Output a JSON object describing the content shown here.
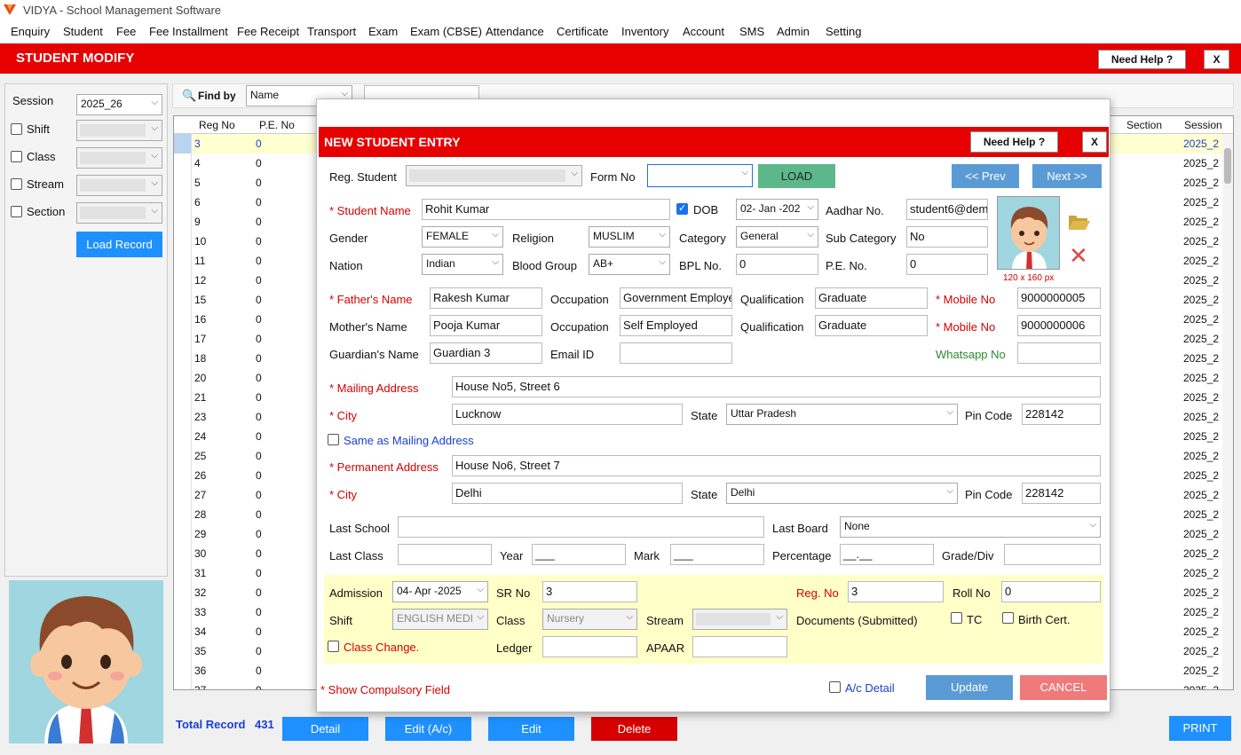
{
  "app": {
    "title": "VIDYA - School Management Software"
  },
  "menu": [
    "Enquiry",
    "Student",
    "Fee",
    "Fee Installment",
    "Fee Receipt",
    "Transport",
    "Exam",
    "Exam (CBSE)",
    "Attendance",
    "Certificate",
    "Inventory",
    "Account",
    "SMS",
    "Admin",
    "Setting"
  ],
  "page": {
    "title": "STUDENT MODIFY",
    "help": "Need Help ?",
    "close": "X"
  },
  "left": {
    "session_label": "Session",
    "session_value": "2025_26",
    "shift_label": "Shift",
    "class_label": "Class",
    "stream_label": "Stream",
    "section_label": "Section",
    "load_button": "Load Record"
  },
  "toolbar": {
    "find_by": "Find by",
    "find_value": "Name"
  },
  "grid": {
    "col_regno": "Reg No",
    "col_pe": "P.E. No",
    "col_section": "Section",
    "col_session": "Session",
    "rows": [
      {
        "reg": "3",
        "pe": "0",
        "session": "2025_2"
      },
      {
        "reg": "4",
        "pe": "0",
        "session": "2025_2"
      },
      {
        "reg": "5",
        "pe": "0",
        "session": "2025_2"
      },
      {
        "reg": "6",
        "pe": "0",
        "session": "2025_2"
      },
      {
        "reg": "9",
        "pe": "0",
        "session": "2025_2"
      },
      {
        "reg": "10",
        "pe": "0",
        "session": "2025_2"
      },
      {
        "reg": "11",
        "pe": "0",
        "session": "2025_2"
      },
      {
        "reg": "12",
        "pe": "0",
        "session": "2025_2"
      },
      {
        "reg": "15",
        "pe": "0",
        "session": "2025_2"
      },
      {
        "reg": "16",
        "pe": "0",
        "session": "2025_2"
      },
      {
        "reg": "17",
        "pe": "0",
        "session": "2025_2"
      },
      {
        "reg": "18",
        "pe": "0",
        "session": "2025_2"
      },
      {
        "reg": "20",
        "pe": "0",
        "session": "2025_2"
      },
      {
        "reg": "21",
        "pe": "0",
        "session": "2025_2"
      },
      {
        "reg": "23",
        "pe": "0",
        "session": "2025_2"
      },
      {
        "reg": "24",
        "pe": "0",
        "session": "2025_2"
      },
      {
        "reg": "25",
        "pe": "0",
        "session": "2025_2"
      },
      {
        "reg": "26",
        "pe": "0",
        "session": "2025_2"
      },
      {
        "reg": "27",
        "pe": "0",
        "session": "2025_2"
      },
      {
        "reg": "28",
        "pe": "0",
        "session": "2025_2"
      },
      {
        "reg": "29",
        "pe": "0",
        "session": "2025_2"
      },
      {
        "reg": "30",
        "pe": "0",
        "session": "2025_2"
      },
      {
        "reg": "31",
        "pe": "0",
        "session": "2025_2"
      },
      {
        "reg": "32",
        "pe": "0",
        "session": "2025_2"
      },
      {
        "reg": "33",
        "pe": "0",
        "session": "2025_2"
      },
      {
        "reg": "34",
        "pe": "0",
        "session": "2025_2"
      },
      {
        "reg": "35",
        "pe": "0",
        "session": "2025_2"
      },
      {
        "reg": "36",
        "pe": "0",
        "session": "2025_2"
      },
      {
        "reg": "37",
        "pe": "0",
        "session": "2025_2"
      }
    ]
  },
  "bottom": {
    "total_label": "Total Record",
    "total_value": "431",
    "detail": "Detail",
    "edit_ac": "Edit (A/c)",
    "edit": "Edit",
    "delete": "Delete",
    "print": "PRINT"
  },
  "dialog": {
    "title": "NEW STUDENT ENTRY",
    "help": "Need Help ?",
    "close": "X",
    "reg_student_label": "Reg. Student",
    "form_no_label": "Form No",
    "load": "LOAD",
    "prev": "<< Prev",
    "next": "Next >>",
    "student_name_label": "* Student Name",
    "student_name": "Rohit Kumar",
    "dob_label": "DOB",
    "dob_value": "02- Jan -202",
    "aadhar_label": "Aadhar No.",
    "aadhar_value": "student6@dem",
    "gender_label": "Gender",
    "gender_value": "FEMALE",
    "religion_label": "Religion",
    "religion_value": "MUSLIM",
    "category_label": "Category",
    "category_value": "General",
    "subcategory_label": "Sub Category",
    "subcategory_value": "No",
    "nation_label": "Nation",
    "nation_value": "Indian",
    "blood_label": "Blood Group",
    "blood_value": "AB+",
    "bpl_label": "BPL No.",
    "bpl_value": "0",
    "pe_label": "P.E. No.",
    "pe_value": "0",
    "photo_caption": "120 x 160 px",
    "father_label": "* Father's Name",
    "father_value": "Rakesh Kumar",
    "occupation_label": "Occupation",
    "father_occ": "Government Employe",
    "qualification_label": "Qualification",
    "father_qual": "Graduate",
    "mobile_label": "* Mobile  No",
    "father_mobile": "9000000005",
    "mother_label": "Mother's Name",
    "mother_value": "Pooja Kumar",
    "mother_occ": "Self Employed",
    "mother_qual": "Graduate",
    "mobile2_label": "* Mobile No",
    "mother_mobile": "9000000006",
    "guardian_label": "Guardian's Name",
    "guardian_value": "Guardian 3",
    "email_label": "Email ID",
    "whatsapp_label": "Whatsapp No",
    "mailing_label": "* Mailing Address",
    "mailing_value": "House No5, Street 6",
    "city_label": "* City",
    "city_value": "Lucknow",
    "state_label": "State",
    "state_value": "Uttar Pradesh",
    "pin_label": "Pin Code",
    "pin_value": "228142",
    "same_label": "Same as Mailing Address",
    "perm_label": "* Permanent Address",
    "perm_value": "House No6, Street 7",
    "city2_value": "Delhi",
    "state2_value": "Delhi",
    "pin2_value": "228142",
    "last_school_label": "Last School",
    "last_board_label": "Last Board",
    "last_board_value": "None",
    "last_class_label": "Last Class",
    "year_label": "Year",
    "year_value": "___",
    "mark_label": "Mark",
    "mark_value": "___",
    "percentage_label": "Percentage",
    "percentage_value": "__.__",
    "grade_label": "Grade/Div",
    "admission_label": "Admission",
    "admission_value": "04- Apr -2025",
    "sr_label": "SR No",
    "sr_value": "3",
    "regno_label": "Reg. No",
    "regno_value": "3",
    "rollno_label": "Roll No",
    "rollno_value": "0",
    "shift_label": "Shift",
    "shift_value": "ENGLISH MEDI",
    "class_label": "Class",
    "class_value": "Nursery",
    "stream_label": "Stream",
    "documents_label": "Documents (Submitted)",
    "tc_label": "TC",
    "birth_label": "Birth Cert.",
    "class_change_label": "Class Change.",
    "ledger_label": "Ledger",
    "apaar_label": "APAAR",
    "compulsory": "* Show Compulsory Field",
    "ac_detail": "A/c Detail",
    "update": "Update",
    "cancel": "CANCEL"
  }
}
